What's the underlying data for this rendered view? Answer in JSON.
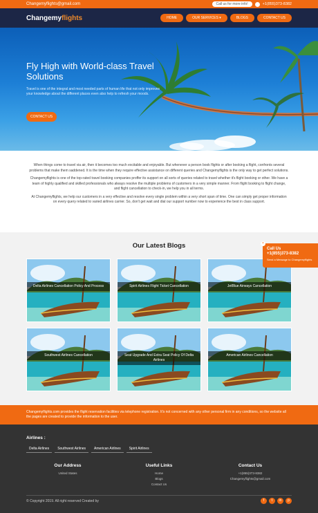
{
  "topbar": {
    "email": "Changemyflights@gmail.com",
    "call_label": "Call us for more info!",
    "phone": "+1(855)373-8382"
  },
  "header": {
    "logo_main": "Changemy",
    "logo_accent": "flights",
    "nav": [
      "Home",
      "Our Services ▾",
      "Blogs",
      "Contact Us"
    ]
  },
  "hero": {
    "title": "Fly High with World-class Travel Solutions",
    "description": "Travel is one of the integral and most needed parts of human life that not only improves your knowledge about the different places even also help to refresh your moods.",
    "cta": "Contact Us"
  },
  "intro": {
    "p1": "When things come to travel via air, then it becomes too much excitable and enjoyable. But whenever a person book flights or after booking a flight, confronts several problems that make them saddened. It is the time when they require effective assistance on different queries and Changemyflights is the only way to get perfect solutions.",
    "p2": "Changemyflights is one of the top-rated travel booking companies proffer its support on all sorts of queries related to travel whether it's flight booking or other. We have a team of highly qualified and skilled professionals who always resolve the multiple problems of customers in a very simple manner. From flight booking to flight change, and flight cancellation to check-in, we help you in all terms.",
    "p3": "At Changemyflights, we help our customers in a very effective and resolve every single problem within a very short span of time. One can simply get proper information on every query related to varied airlines carrier. So, don't get wait and dial our support number now to experience the best in class support."
  },
  "blogs": {
    "heading": "Our Latest Blogs",
    "items": [
      "Delta Airlines Cancellation Policy And Process",
      "Spirit Airlines Flight Ticket Cancellation",
      "JetBlue Airways Cancellation",
      "Southwest Airlines Cancellation",
      "Seat Upgrade And Extra Seat Policy Of Delta Airlines",
      "American Airlines Cancellation"
    ]
  },
  "call_widget": {
    "close": "×",
    "title": "Call Us",
    "phone": "+1(855)373-8382",
    "subtitle": "Send a Message to Changemyflights"
  },
  "disclaimer": "Changemyflights.com provides the flight reservation facilities via telephone registration. It's not concerned with any other personal firm in any conditions, so the website all the pages are created to provide the information to the user.",
  "footer": {
    "airlines_title": "Airlines :",
    "airlines": [
      "Delta Airlines",
      "Southwest Airlines",
      "American Airlines",
      "Spirit Airlines"
    ],
    "address_title": "Our Address",
    "address": "United States",
    "links_title": "Useful Links",
    "links": [
      "Home",
      "Blogs",
      "Contact Us"
    ],
    "contact_title": "Contact Us",
    "contact_phone": "+1(855)373-8382",
    "contact_email": "Changemyflights@gmail.com",
    "copyright": "© Copyright 2019. All right reserved Created by",
    "socials": [
      "f",
      "t",
      "in",
      "p"
    ]
  },
  "colors": {
    "accent": "#f06a12",
    "header_bg": "#1c2646",
    "footer_bg": "#333333"
  }
}
